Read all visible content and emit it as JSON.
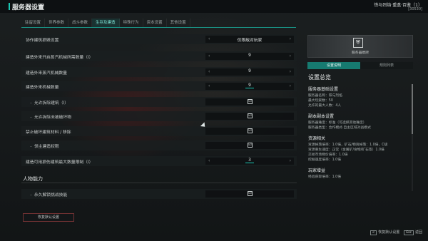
{
  "header": {
    "title": "服务器设置",
    "user_name": "铁与烈焰·重盒·百鉴（1）",
    "user_sub": "[30530]"
  },
  "tabs": [
    "驻留设置",
    "世界参数",
    "战斗参数",
    "生存及建造",
    "特殊行为",
    "资本设置",
    "其他设置"
  ],
  "active_tab": 3,
  "rows": [
    {
      "label": "协作建筑损毁设置",
      "type": "select",
      "value": "仅限敌对玩家"
    },
    {
      "label": "建造外来开启蒸汽机械所需数量（I）",
      "type": "stepper",
      "value": "9"
    },
    {
      "label": "建造外来蒸汽机械数量",
      "type": "stepper",
      "value": "9"
    },
    {
      "label": "建造外来机械数量",
      "type": "stepper",
      "value": "9",
      "underline": true
    },
    {
      "label": "允许拆除建筑（I）",
      "type": "checkbox",
      "checked": true,
      "sub": true
    },
    {
      "label": "允许拆除未被破坏物",
      "type": "checkbox",
      "checked": true,
      "sub": true
    },
    {
      "label": "禁止破坏建筑材料 / 移除",
      "type": "checkbox",
      "checked": true
    },
    {
      "label": "领主建造权限",
      "type": "checkbox",
      "checked": true,
      "sub": true
    },
    {
      "label": "建造可用损伤建筑最大数量限制（I）",
      "type": "stepper",
      "value": "3",
      "underline": true
    }
  ],
  "section2": {
    "title": "人物能力",
    "rows": [
      {
        "label": "永久解锁挑战技能",
        "type": "checkbox",
        "checked": true
      }
    ]
  },
  "reset_button": "恢复默认设置",
  "preview": {
    "label": "服务器盾牌",
    "icon": "shield-icon"
  },
  "right_tabs": [
    "设置说明",
    "规则列表"
  ],
  "right_active": 0,
  "summary": {
    "title": "设置总览",
    "blocks": [
      {
        "head": "服务器基础设置",
        "lines": [
          "服务器名称：铁与烈焰",
          "最大玩家数：50",
          "允许的最大人数：4人"
        ]
      },
      {
        "head": "副本副本设置",
        "lines": [
          "服务器难度：标准（可选择其他难度）",
          "服务器类型：合作模式·自主区域对战模式"
        ]
      },
      {
        "head": "资源相关",
        "lines": [
          "资源掉落倍率：1.0倍，矿石/物资掉落：1.0倍，C级",
          "资源重生速度：正常（金属矿/食物/矿石等）1.0倍",
          "交易市场物价倍率：1.0倍",
          "挖掘速度倍率：1.0倍"
        ]
      },
      {
        "head": "玩家增益",
        "lines": [
          "经验获取倍率：1.0倍"
        ]
      }
    ]
  },
  "footer": {
    "items": [
      {
        "key": "<",
        "label": "恢复默认设置"
      },
      {
        "key": "Esc",
        "label": "返回"
      }
    ]
  },
  "checkbox_glyph": "☑",
  "colors": {
    "accent": "#19c7b3",
    "active_tab_bg": "#167a70"
  }
}
